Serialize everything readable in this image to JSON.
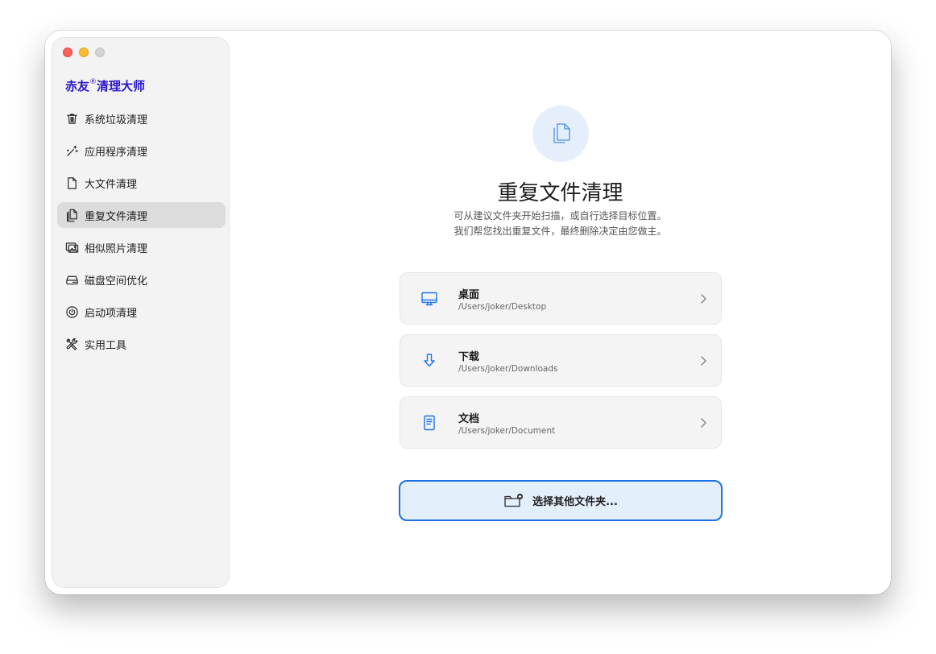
{
  "app": {
    "brand_name": "赤友",
    "brand_mark": "®",
    "brand_suffix": "清理大师"
  },
  "sidebar": {
    "items": [
      {
        "label": "系统垃圾清理",
        "icon": "trash-icon",
        "active": false
      },
      {
        "label": "应用程序清理",
        "icon": "magic-wand-icon",
        "active": false
      },
      {
        "label": "大文件清理",
        "icon": "document-icon",
        "active": false
      },
      {
        "label": "重复文件清理",
        "icon": "duplicate-files-icon",
        "active": true
      },
      {
        "label": "相似照片清理",
        "icon": "photos-icon",
        "active": false
      },
      {
        "label": "磁盘空间优化",
        "icon": "disk-drive-icon",
        "active": false
      },
      {
        "label": "启动项清理",
        "icon": "power-icon",
        "active": false
      },
      {
        "label": "实用工具",
        "icon": "tools-icon",
        "active": false
      }
    ]
  },
  "main": {
    "hero_icon": "duplicate-files-icon",
    "title": "重复文件清理",
    "subtitle_line1": "可从建议文件夹开始扫描，或自行选择目标位置。",
    "subtitle_line2": "我们帮您找出重复文件，最终删除决定由您做主。",
    "locations": [
      {
        "name": "桌面",
        "path": "/Users/joker/Desktop",
        "icon": "desktop-icon"
      },
      {
        "name": "下载",
        "path": "/Users/joker/Downloads",
        "icon": "download-icon"
      },
      {
        "name": "文档",
        "path": "/Users/joker/Document",
        "icon": "document-icon"
      }
    ],
    "choose_button_label": "选择其他文件夹...",
    "choose_button_icon": "folder-add-icon"
  },
  "colors": {
    "accent": "#1f72e6",
    "brand": "#2a16c8",
    "sidebar_bg": "#f3f3f3",
    "active_item_bg": "#dcdcdc"
  }
}
